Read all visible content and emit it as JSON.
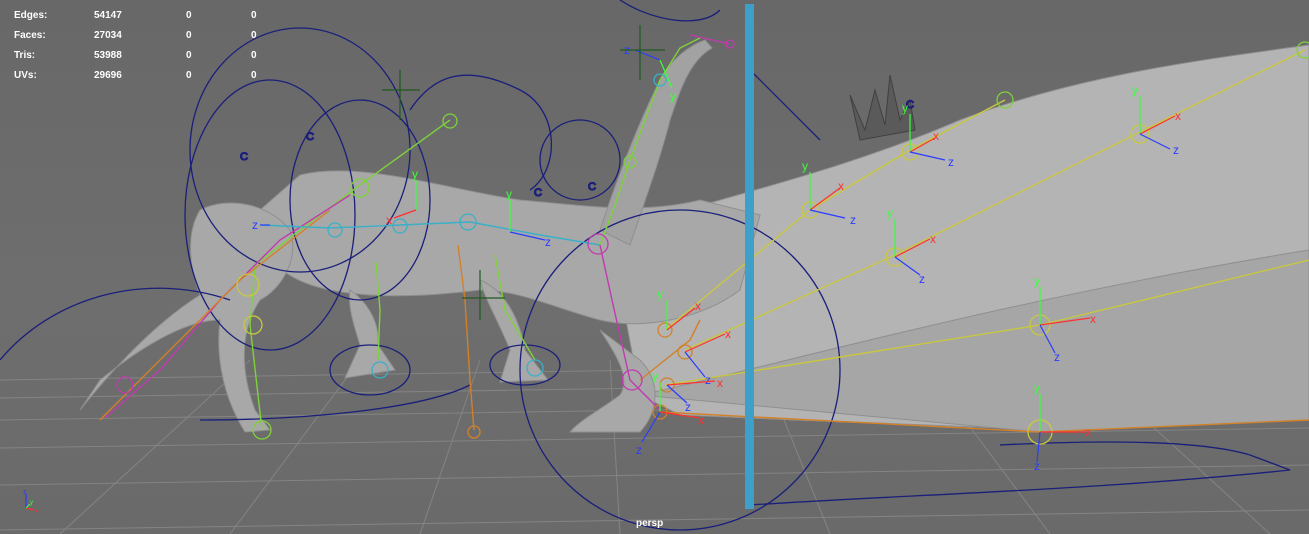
{
  "stats": {
    "rows": [
      {
        "label": "Edges:",
        "values": [
          "54147",
          "0",
          "0"
        ]
      },
      {
        "label": "Faces:",
        "values": [
          "27034",
          "0",
          "0"
        ]
      },
      {
        "label": "Tris:",
        "values": [
          "53988",
          "0",
          "0"
        ]
      },
      {
        "label": "UVs:",
        "values": [
          "29696",
          "0",
          "0"
        ]
      }
    ]
  },
  "camera": {
    "label": "persp"
  },
  "gizmo": {
    "x": "x",
    "y": "y",
    "z": "z"
  },
  "colors": {
    "viewport_bg": "#6b6b6b",
    "mesh": "#a9a9a9",
    "grid": "#8a8a8a",
    "control_curve": "#1a1f7a",
    "joint_green": "#7ed23a",
    "joint_yellow": "#c8c840",
    "joint_orange": "#d2812a",
    "joint_magenta": "#c23ab0",
    "joint_cyan": "#3ab0c8",
    "axis_x": "#ff3030",
    "axis_y": "#3cff3c",
    "axis_z": "#2a3cff",
    "splitter": "#3e9fc8"
  }
}
